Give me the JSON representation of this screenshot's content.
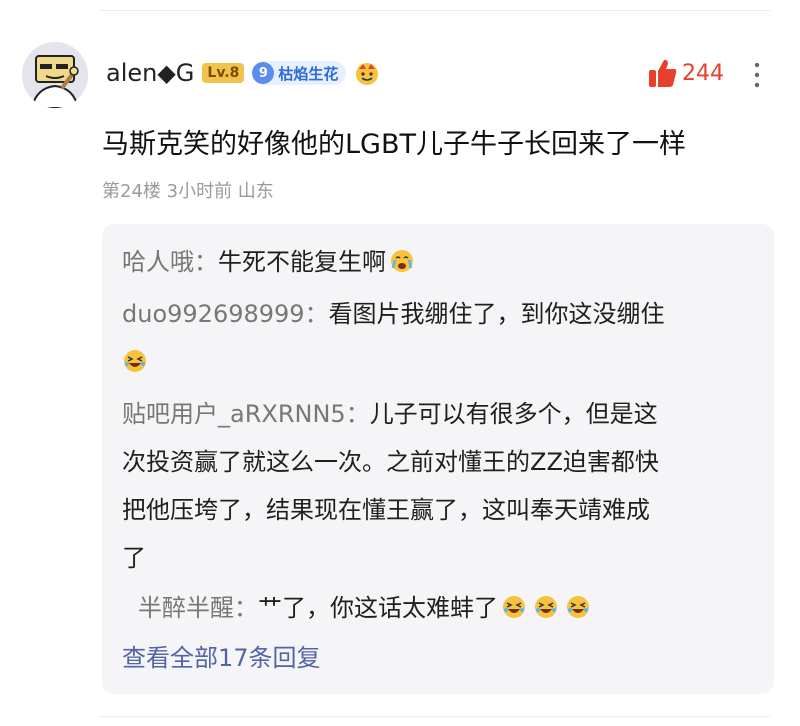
{
  "comment": {
    "author": "alen◆G",
    "level_badge": "Lv.8",
    "fan_badge": {
      "level": "9",
      "name": "枯焰生花"
    },
    "likes": "244",
    "text": "马斯克笑的好像他的LGBT儿子牛子长回来了一样",
    "meta": "第24楼  3小时前  山东"
  },
  "replies": [
    {
      "name": "哈人哦",
      "text": "牛死不能复生啊"
    },
    {
      "name": "duo992698999",
      "text": "看图片我绷住了，到你这没绷住"
    },
    {
      "name": "贴吧用户_aRXRNN5",
      "line1": "儿子可以有很多个，但是这",
      "line2": "次投资赢了就这么一次。之前对懂王的ZZ迫害都快",
      "line3": "把他压垮了，结果现在懂王赢了，这叫奉天靖难成",
      "line4": "了"
    },
    {
      "name": "半醉半醒",
      "text": "艹了，你这话太难蚌了"
    }
  ],
  "view_all": "查看全部17条回复",
  "colors": {
    "like": "#e8402d",
    "link": "#5263a6",
    "level_badge": "#f3c24a",
    "fan_badge": "#5b8df0"
  },
  "icons": [
    "avatar",
    "thumbs-up-icon",
    "more-icon",
    "crying-emoji-icon",
    "laughing-emoji-icon"
  ]
}
